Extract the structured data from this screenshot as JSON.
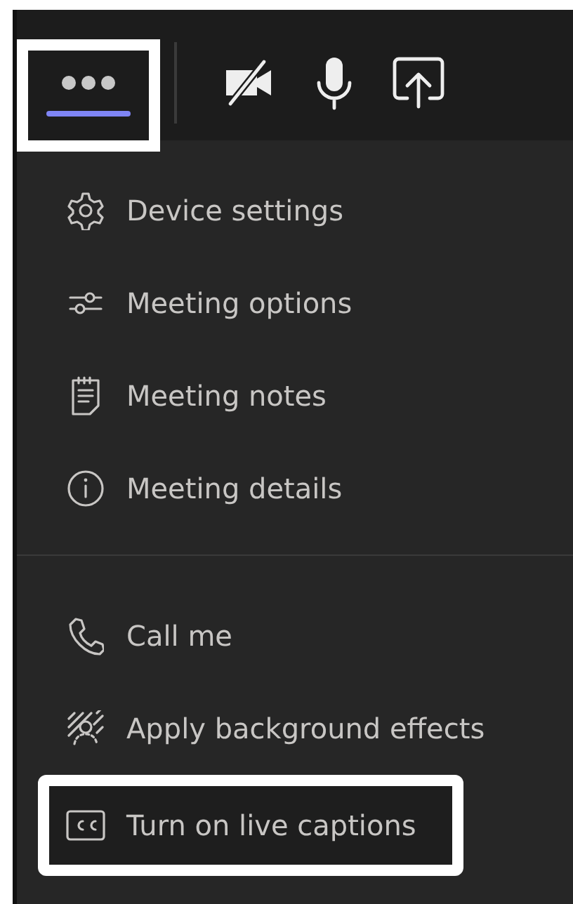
{
  "toolbar": {
    "buttons": [
      {
        "kind": "more",
        "selected": true,
        "highlighted": true
      },
      {
        "kind": "camera-off",
        "selected": false,
        "highlighted": false
      },
      {
        "kind": "mic",
        "selected": false,
        "highlighted": false
      },
      {
        "kind": "share",
        "selected": false,
        "highlighted": false
      }
    ]
  },
  "menu": {
    "sections": [
      {
        "items": [
          {
            "kind": "gear",
            "label": "Device settings",
            "highlighted": false
          },
          {
            "kind": "sliders",
            "label": "Meeting options",
            "highlighted": false
          },
          {
            "kind": "notes",
            "label": "Meeting notes",
            "highlighted": false
          },
          {
            "kind": "info",
            "label": "Meeting details",
            "highlighted": false
          }
        ]
      },
      {
        "items": [
          {
            "kind": "phone",
            "label": "Call me",
            "highlighted": false
          },
          {
            "kind": "effects",
            "label": "Apply background effects",
            "highlighted": false
          },
          {
            "kind": "cc",
            "label": "Turn on live captions",
            "highlighted": true
          }
        ]
      }
    ]
  }
}
